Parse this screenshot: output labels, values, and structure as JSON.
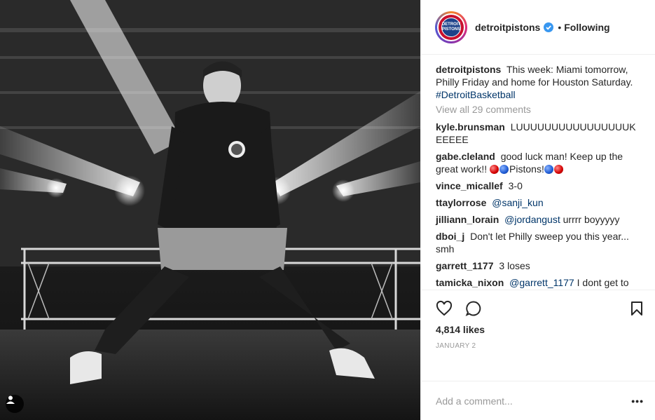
{
  "post": {
    "username": "detroitpistons",
    "follow_status": "Following",
    "separator": "•",
    "avatar_text": "DETROIT PISTONS"
  },
  "caption": {
    "username": "detroitpistons",
    "text": "This week: Miami tomorrow, Philly Friday and home for Houston Saturday.",
    "hashtag": "#DetroitBasketball"
  },
  "view_all_comments": "View all 29 comments",
  "comments": [
    {
      "username": "kyle.brunsman",
      "text": "LUUUUUUUUUUUUUUUUK EEEEE"
    },
    {
      "username": "gabe.cleland",
      "text": "good luck man! Keep up the great work!!",
      "text2": "Pistons!"
    },
    {
      "username": "vince_micallef",
      "text": "3-0"
    },
    {
      "username": "ttaylorrose",
      "mention": "@sanji_kun"
    },
    {
      "username": "jilliann_lorain",
      "mention": "@jordangust",
      "text": "urrrr boyyyyy"
    },
    {
      "username": "dboi_j",
      "text": "Don't let Philly sweep you this year... smh"
    },
    {
      "username": "garrett_1177",
      "text": "3 loses"
    },
    {
      "username": "tamicka_nixon",
      "mention": "@garrett_1177",
      "text": "I dont get to how y'all be pistons fans but always talking negative and what if they win all of those"
    }
  ],
  "likes": "4,814 likes",
  "date": "JANUARY 2",
  "add_comment_placeholder": "Add a comment...",
  "more_label": "•••",
  "colors": {
    "link": "#003569",
    "muted": "#999999",
    "verified": "#3897f0",
    "brand_red": "#c8102e",
    "brand_blue": "#1d428a"
  },
  "icons": [
    "heart-icon",
    "comment-icon",
    "bookmark-icon",
    "user-tag-icon",
    "verified-badge-icon"
  ]
}
